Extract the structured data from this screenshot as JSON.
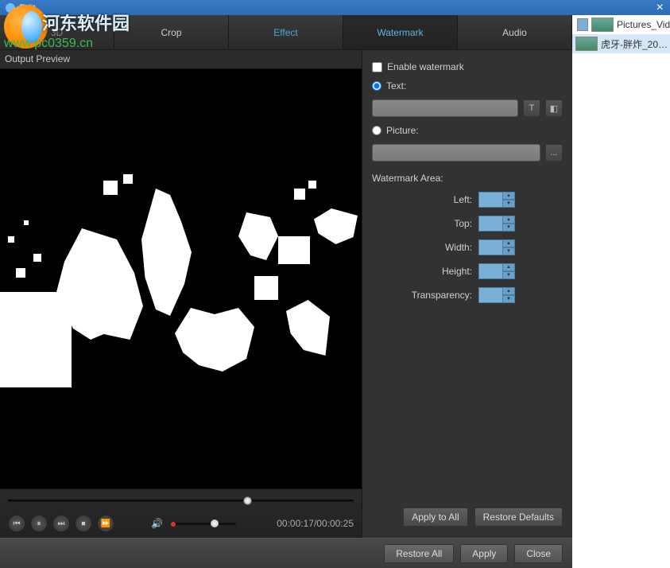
{
  "window": {
    "title": "Edit",
    "close": "×"
  },
  "watermark_overlay": {
    "name": "河东软件园",
    "url": "www.pc0359.cn"
  },
  "tabs": {
    "0": {
      "label": "3D"
    },
    "1": {
      "label": "Crop"
    },
    "2": {
      "label": "Effect"
    },
    "3": {
      "label": "Watermark"
    },
    "4": {
      "label": "Audio"
    }
  },
  "preview": {
    "header": "Output Preview"
  },
  "watermark": {
    "enable_label": "Enable watermark",
    "enable_checked": false,
    "text_label": "Text:",
    "text_value": "",
    "picture_label": "Picture:",
    "picture_value": "",
    "area_label": "Watermark Area:",
    "left_label": "Left:",
    "top_label": "Top:",
    "width_label": "Width:",
    "height_label": "Height:",
    "transparency_label": "Transparency:",
    "left": "",
    "top": "",
    "width": "",
    "height": "",
    "transparency": "",
    "browse_glyph": "...",
    "text_tool_glyph": "T"
  },
  "buttons": {
    "apply_all": "Apply to All",
    "restore_defaults": "Restore Defaults",
    "restore_all": "Restore All",
    "apply": "Apply",
    "close": "Close"
  },
  "playback": {
    "current": "00:00:17",
    "total": "00:00:25",
    "seek_percent": 68,
    "volume_percent": 60
  },
  "sidebar": {
    "items": {
      "0": {
        "label": "Pictures_Vid…"
      },
      "1": {
        "label": "虎牙-胖炸_20…"
      }
    }
  }
}
